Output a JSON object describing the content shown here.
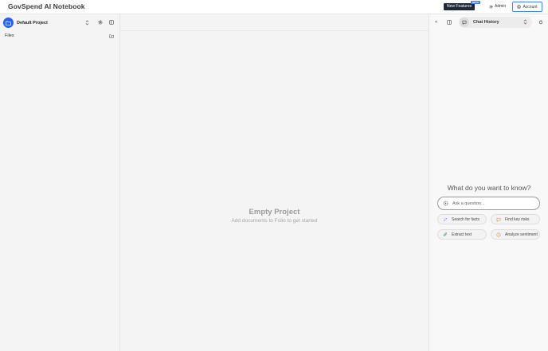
{
  "app": {
    "title": "GovSpend AI Notebook"
  },
  "header": {
    "new_features_label": "New Features",
    "beta_label": "BETA",
    "admin_label": "Admin",
    "account_label": "Account"
  },
  "sidebar": {
    "project_name": "Default Project",
    "files_label": "Files"
  },
  "main": {
    "empty_title": "Empty Project",
    "empty_subtitle": "Add documents to Folio to get started"
  },
  "chat": {
    "history_label": "Chat History",
    "collapse_label": "«",
    "prompt_title": "What do you want to know?",
    "input_placeholder": "Ask a question...",
    "suggestions": [
      {
        "label": "Search for facts",
        "icon": "sparkle-search-icon"
      },
      {
        "label": "Find key risks",
        "icon": "speech-bubble-icon"
      },
      {
        "label": "Extract text",
        "icon": "paperclip-icon"
      },
      {
        "label": "Analyze sentiment",
        "icon": "smile-icon"
      }
    ]
  },
  "colors": {
    "accent": "#2563eb",
    "account_border": "#3b82f6",
    "new_features_bg": "#1f2937",
    "beta_bg": "#3b82f6",
    "chip_icon_blue": "#5b8def",
    "chip_icon_orange": "#e9965a",
    "chip_icon_green": "#4caf7a"
  }
}
